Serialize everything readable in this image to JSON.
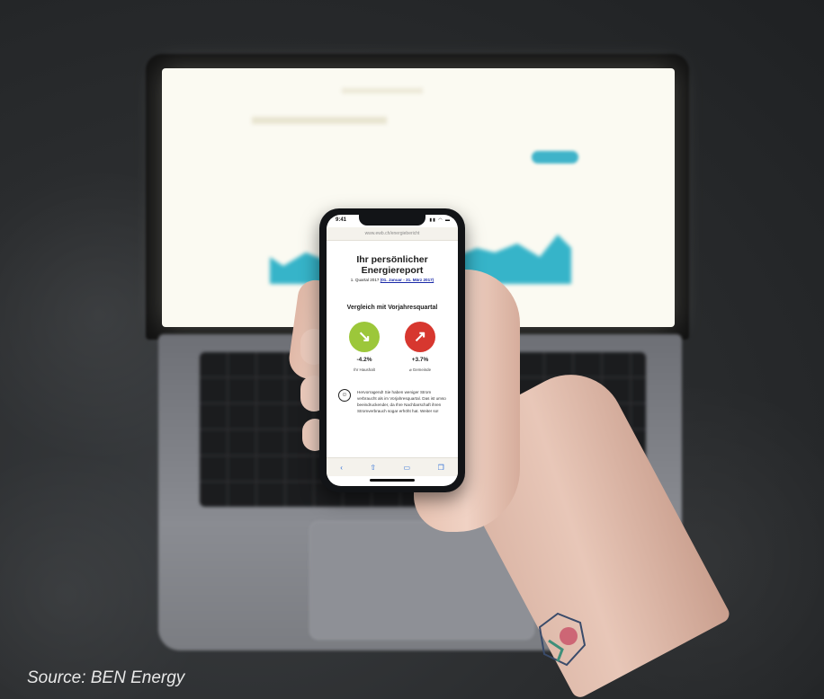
{
  "phone": {
    "status_time": "9:41",
    "status_icons": "▮▮ ◠ ▬",
    "url": "www.ewb.ch/energiebericht",
    "report": {
      "title_line1": "Ihr persönlicher",
      "title_line2": "Energiereport",
      "subtitle_prefix": "1. Quartal 2017 ",
      "subtitle_link": "(01. Januar - 31. März 2017)",
      "section_title": "Vergleich mit Vorjahresquartal",
      "household": {
        "value": "-4.2%",
        "label": "Ihr Haushalt",
        "arrow": "↘"
      },
      "community": {
        "value": "+3.7%",
        "label": "⌀ Gemeinde",
        "arrow": "↗"
      },
      "message": "Hervorragend! Sie haben weniger Strom verbraucht als im Vorjahresquartal. Das ist umso beeindruckender, da Ihre Nachbarschaft ihren Stromverbrauch sogar erhöht hat. Weiter so!"
    },
    "toolbar": {
      "back": "‹",
      "share": "⇧",
      "bookmarks": "▭",
      "tabs": "❐"
    }
  },
  "colors": {
    "green": "#9cc73a",
    "red": "#d7372f",
    "link": "#1a2aa8"
  },
  "caption": "Source: BEN Energy"
}
